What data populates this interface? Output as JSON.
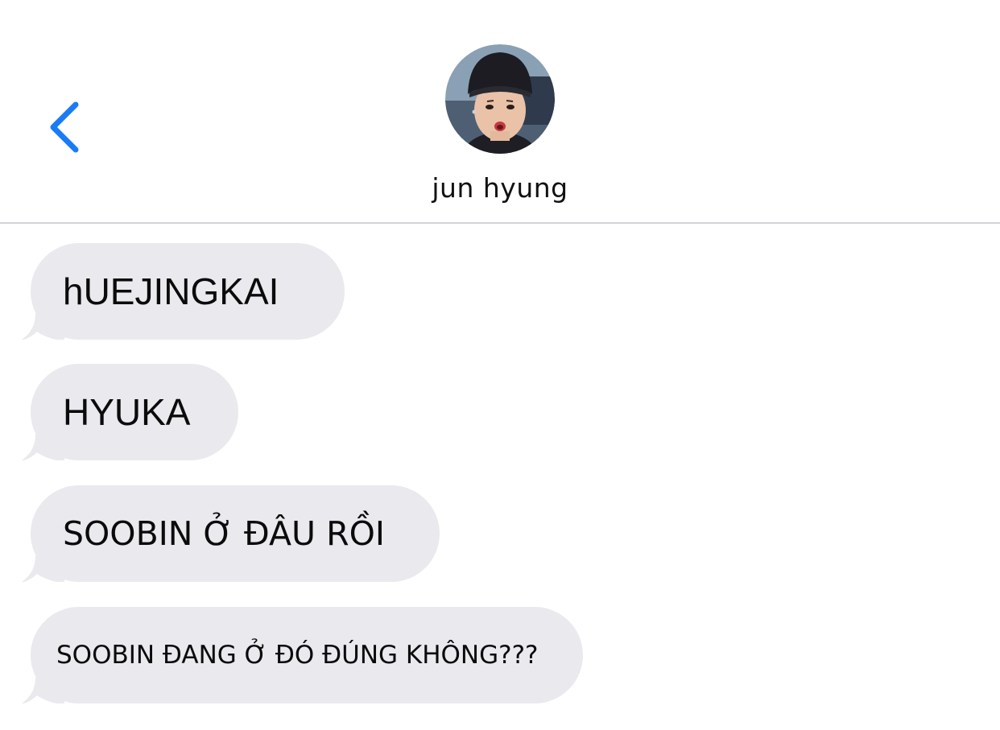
{
  "header": {
    "back_icon": "chevron-left-icon",
    "contact_name": "jun hyung",
    "avatar_icon": "contact-avatar-photo"
  },
  "colors": {
    "accent": "#1a7cf5",
    "bubble": "#e9e9ee",
    "divider": "#d4d4d8",
    "text": "#0b0b0b"
  },
  "messages": [
    {
      "direction": "incoming",
      "text": "hUEJINGKAI"
    },
    {
      "direction": "incoming",
      "text": "HYUKA"
    },
    {
      "direction": "incoming",
      "text": "SOOBIN Ở ĐÂU RỒI"
    },
    {
      "direction": "incoming",
      "text": "SOOBIN ĐANG Ở ĐÓ ĐÚNG KHÔNG???"
    }
  ]
}
